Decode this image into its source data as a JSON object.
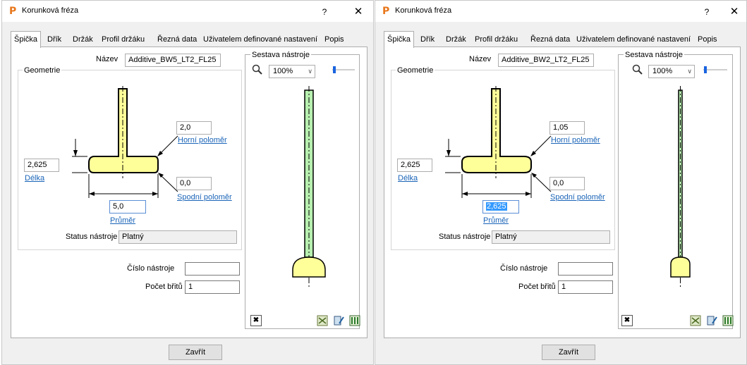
{
  "dialogs": [
    {
      "app_icon": "P",
      "title": "Korunková fréza",
      "help_label": "?",
      "close_label": "✕",
      "tabs": [
        "Špička",
        "Dřík",
        "Držák",
        "Profil držáku",
        "Řezná data",
        "Uživatelem definované nastavení",
        "Popis"
      ],
      "active_tab": "Špička",
      "name_label": "Název",
      "name_value": "Additive_BW5_LT2_FL25",
      "geometry_label": "Geometrie",
      "upper_radius_value": "2,0",
      "upper_radius_label": "Horní poloměr",
      "length_value": "2,625",
      "length_label": "Délka",
      "lower_radius_value": "0,0",
      "lower_radius_label": "Spodní poloměr",
      "diameter_value": "5,0",
      "diameter_label": "Průměr",
      "status_label": "Status nástroje",
      "status_value": "Platný",
      "assembly_label": "Sestava nástroje",
      "zoom_value": "100%",
      "tool_number_label": "Číslo nástroje",
      "tool_number_value": "",
      "flutes_label": "Počet břitů",
      "flutes_value": "1",
      "close_button": "Zavřít"
    },
    {
      "app_icon": "P",
      "title": "Korunková fréza",
      "help_label": "?",
      "close_label": "✕",
      "tabs": [
        "Špička",
        "Dřík",
        "Držák",
        "Profil držáku",
        "Řezná data",
        "Uživatelem definované nastavení",
        "Popis"
      ],
      "active_tab": "Špička",
      "name_label": "Název",
      "name_value": "Additive_BW2_LT2_FL25",
      "geometry_label": "Geometrie",
      "upper_radius_value": "1,05",
      "upper_radius_label": "Horní poloměr",
      "length_value": "2,625",
      "length_label": "Délka",
      "lower_radius_value": "0,0",
      "lower_radius_label": "Spodní poloměr",
      "diameter_value": "2,625",
      "diameter_label": "Průměr",
      "status_label": "Status nástroje",
      "status_value": "Platný",
      "assembly_label": "Sestava nástroje",
      "zoom_value": "100%",
      "tool_number_label": "Číslo nástroje",
      "tool_number_value": "",
      "flutes_label": "Počet břitů",
      "flutes_value": "1",
      "close_button": "Zavřít"
    }
  ],
  "colors": {
    "tool_fill": "#ffff99",
    "shank_fill": "#b8f0b0",
    "link": "#1a64b8",
    "selection": "#3399ff",
    "slider_thumb": "#1a64e0"
  },
  "icons": [
    "app-logo-icon",
    "help-icon",
    "close-icon",
    "zoom-icon",
    "delete-icon",
    "tool-view-icon",
    "tool-edit-icon",
    "tool-export-icon"
  ]
}
